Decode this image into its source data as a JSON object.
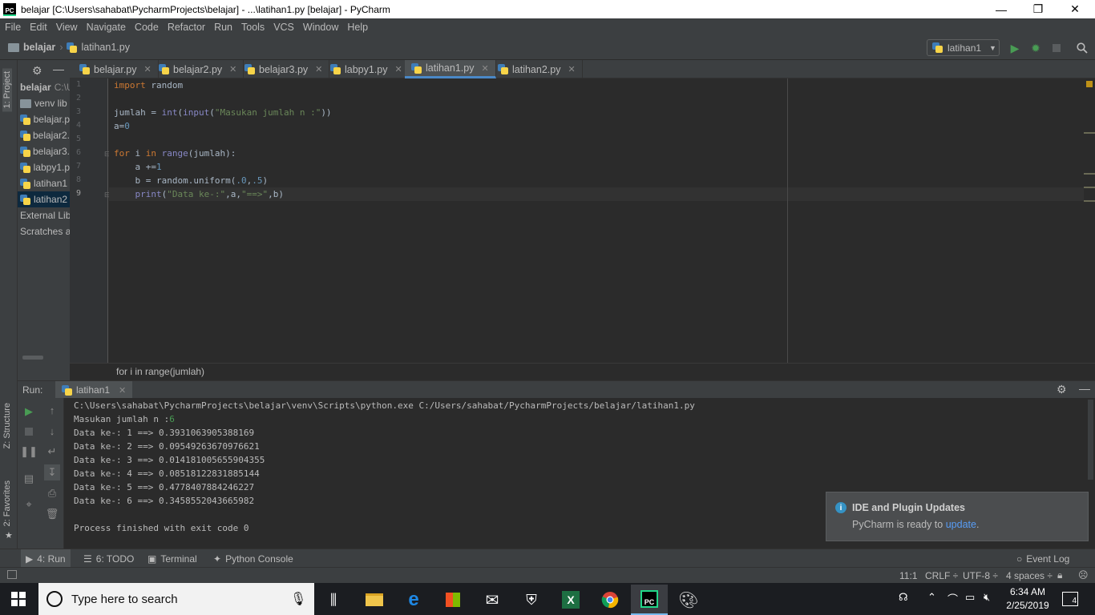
{
  "window": {
    "title": "belajar [C:\\Users\\sahabat\\PycharmProjects\\belajar] - ...\\latihan1.py [belajar] - PyCharm"
  },
  "menu": [
    "File",
    "Edit",
    "View",
    "Navigate",
    "Code",
    "Refactor",
    "Run",
    "Tools",
    "VCS",
    "Window",
    "Help"
  ],
  "nav": {
    "project": "belajar",
    "file": "latihan1.py",
    "run_config": "latihan1"
  },
  "left_tabs": {
    "project": "1: Project",
    "structure": "Z: Structure",
    "favorites": "2: Favorites"
  },
  "project_tree": {
    "root": "belajar",
    "root_path": "C:\\U",
    "items": [
      "venv lib",
      "belajar.p",
      "belajar2.",
      "belajar3.",
      "labpy1.p",
      "latihan1",
      "latihan2"
    ],
    "external": "External Lib",
    "scratches": "Scratches ar"
  },
  "tabs": [
    "belajar.py",
    "belajar2.py",
    "belajar3.py",
    "labpy1.py",
    "latihan1.py",
    "latihan2.py"
  ],
  "active_tab": "latihan1.py",
  "line_numbers": [
    "1",
    "2",
    "3",
    "4",
    "5",
    "6",
    "7",
    "8",
    "9"
  ],
  "code_lines": [
    "import random",
    "",
    "jumlah = int(input(\"Masukan jumlah n :\"))",
    "a=0",
    "",
    "for i in range(jumlah):",
    "    a +=1",
    "    b = random.uniform(.0,.5)",
    "    print(\"Data ke-:\",a,\"==>\",b)"
  ],
  "editor_breadcrumb": "for i in range(jumlah)",
  "run": {
    "label": "Run:",
    "tab": "latihan1",
    "command": "C:\\Users\\sahabat\\PycharmProjects\\belajar\\venv\\Scripts\\python.exe C:/Users/sahabat/PycharmProjects/belajar/latihan1.py",
    "prompt": "Masukan jumlah n :",
    "input": "6",
    "output": [
      "Data ke-: 1 ==> 0.3931063905388169",
      "Data ke-: 2 ==> 0.09549263670976621",
      "Data ke-: 3 ==> 0.014181005655904355",
      "Data ke-: 4 ==> 0.08518122831885144",
      "Data ke-: 5 ==> 0.4778407884246227",
      "Data ke-: 6 ==> 0.3458552043665982"
    ],
    "exit": "Process finished with exit code 0"
  },
  "notification": {
    "title": "IDE and Plugin Updates",
    "text": "PyCharm is ready to ",
    "link": "update",
    "tail": "."
  },
  "bottom_tabs": {
    "run": "4: Run",
    "todo": "6: TODO",
    "terminal": "Terminal",
    "python_console": "Python Console",
    "event_log": "Event Log"
  },
  "status": {
    "position": "11:1",
    "line_sep": "CRLF ÷",
    "encoding": "UTF-8 ÷",
    "indent": "4 spaces ÷"
  },
  "taskbar": {
    "search_placeholder": "Type here to search",
    "time": "6:34 AM",
    "date": "2/25/2019",
    "notifications": "4"
  },
  "colors": {
    "accent": "#4a88c7",
    "run_green": "#499c54",
    "link": "#589df6"
  }
}
